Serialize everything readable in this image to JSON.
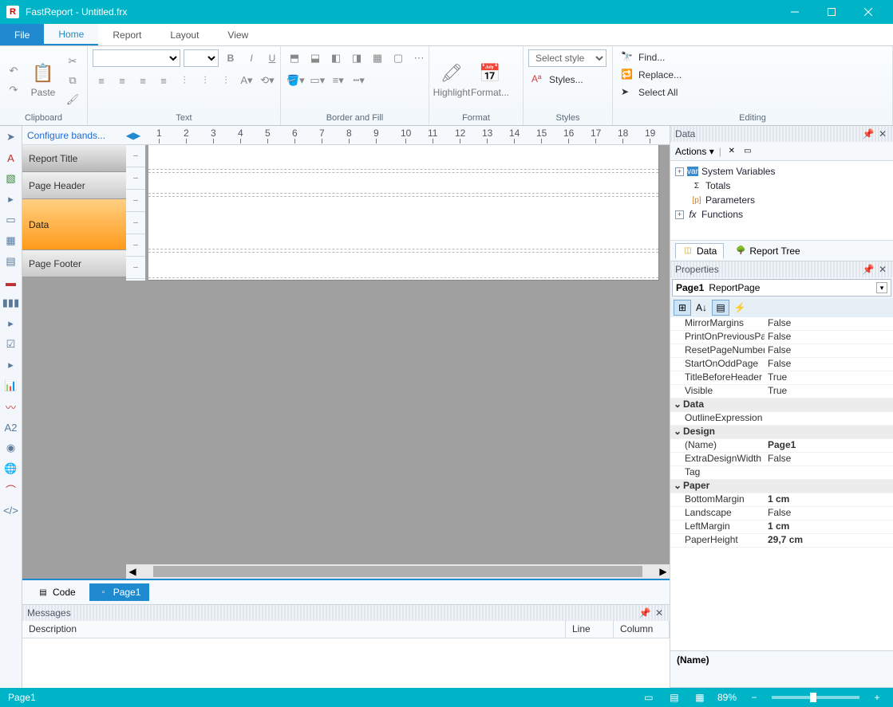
{
  "title": "FastReport - Untitled.frx",
  "menu": {
    "file": "File",
    "home": "Home",
    "report": "Report",
    "layout": "Layout",
    "view": "View"
  },
  "ribbon": {
    "clipboard": {
      "label": "Clipboard",
      "paste": "Paste"
    },
    "text": {
      "label": "Text"
    },
    "border": {
      "label": "Border and Fill"
    },
    "format": {
      "label": "Format",
      "highlight": "Highlight",
      "formatBtn": "Format..."
    },
    "styles": {
      "label": "Styles",
      "selectPlaceholder": "Select style",
      "stylesBtn": "Styles..."
    },
    "editing": {
      "label": "Editing",
      "find": "Find...",
      "replace": "Replace...",
      "selectAll": "Select All"
    }
  },
  "configBands": "Configure bands...",
  "bands": {
    "reportTitle": "Report Title",
    "pageHeader": "Page Header",
    "data": "Data",
    "pageFooter": "Page Footer"
  },
  "pageTabs": {
    "code": "Code",
    "page1": "Page1"
  },
  "dataPanel": {
    "title": "Data",
    "actions": "Actions",
    "tree": {
      "sysvars": "System Variables",
      "totals": "Totals",
      "params": "Parameters",
      "functions": "Functions"
    },
    "tabs": {
      "data": "Data",
      "reportTree": "Report Tree"
    }
  },
  "propsPanel": {
    "title": "Properties",
    "objectName": "Page1",
    "objectType": "ReportPage",
    "rows": [
      {
        "name": "MirrorMargins",
        "value": "False"
      },
      {
        "name": "PrintOnPreviousPa",
        "value": "False"
      },
      {
        "name": "ResetPageNumber",
        "value": "False"
      },
      {
        "name": "StartOnOddPage",
        "value": "False"
      },
      {
        "name": "TitleBeforeHeader",
        "value": "True"
      },
      {
        "name": "Visible",
        "value": "True"
      }
    ],
    "catData": "Data",
    "outlineExpr": {
      "name": "OutlineExpression",
      "value": ""
    },
    "catDesign": "Design",
    "designRows": [
      {
        "name": "(Name)",
        "value": "Page1",
        "bold": true
      },
      {
        "name": "ExtraDesignWidth",
        "value": "False"
      },
      {
        "name": "Tag",
        "value": ""
      }
    ],
    "catPaper": "Paper",
    "paperRows": [
      {
        "name": "BottomMargin",
        "value": "1 cm",
        "bold": true
      },
      {
        "name": "Landscape",
        "value": "False"
      },
      {
        "name": "LeftMargin",
        "value": "1 cm",
        "bold": true
      },
      {
        "name": "PaperHeight",
        "value": "29,7 cm",
        "bold": true
      }
    ],
    "descLabel": "(Name)"
  },
  "messages": {
    "title": "Messages",
    "cols": {
      "description": "Description",
      "line": "Line",
      "column": "Column"
    }
  },
  "status": {
    "page": "Page1",
    "zoom": "89%"
  },
  "rulerTicks": [
    "1",
    "2",
    "3",
    "4",
    "5",
    "6",
    "7",
    "8",
    "9",
    "10",
    "11",
    "12",
    "13",
    "14",
    "15",
    "16",
    "17",
    "18",
    "19"
  ]
}
